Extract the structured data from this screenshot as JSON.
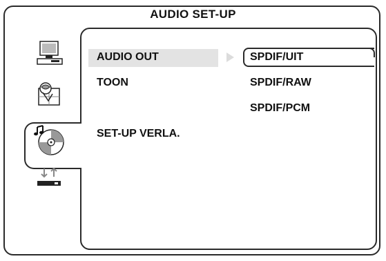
{
  "title": "AUDIO SET-UP",
  "sidebar": {
    "items": [
      {
        "icon": "general-setup-icon"
      },
      {
        "icon": "language-setup-icon"
      },
      {
        "icon": "audio-setup-icon",
        "selected": true
      },
      {
        "icon": "preferences-setup-icon"
      }
    ]
  },
  "menu": {
    "items": [
      {
        "label": "AUDIO OUT",
        "selected": true
      },
      {
        "label": "TOON"
      },
      {
        "label": "SET-UP VERLA."
      }
    ]
  },
  "options": {
    "items": [
      {
        "label": "SPDIF/UIT",
        "selected": true
      },
      {
        "label": "SPDIF/RAW"
      },
      {
        "label": "SPDIF/PCM"
      }
    ]
  },
  "colors": {
    "border": "#2a2a2a",
    "highlight": "#e3e3e3",
    "arrow": "#dcdcdc"
  }
}
